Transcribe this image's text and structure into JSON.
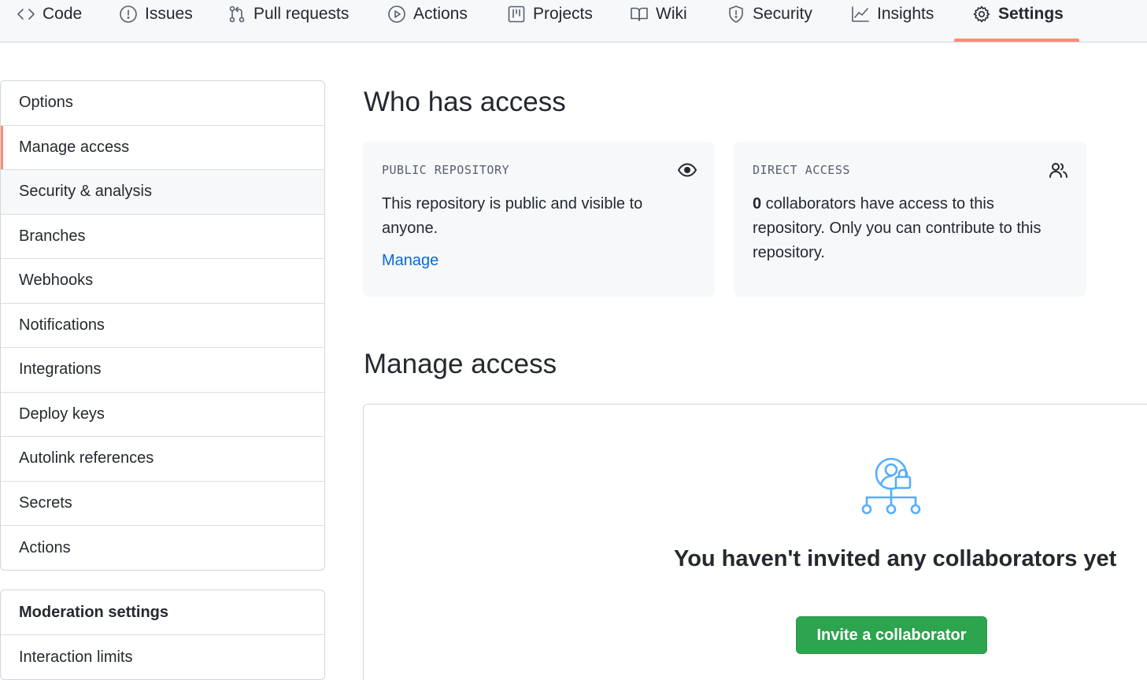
{
  "nav": {
    "tabs": [
      {
        "label": "Code",
        "icon": "code-icon"
      },
      {
        "label": "Issues",
        "icon": "issue-opened-icon"
      },
      {
        "label": "Pull requests",
        "icon": "git-pull-request-icon"
      },
      {
        "label": "Actions",
        "icon": "play-icon"
      },
      {
        "label": "Projects",
        "icon": "project-icon"
      },
      {
        "label": "Wiki",
        "icon": "book-icon"
      },
      {
        "label": "Security",
        "icon": "shield-icon"
      },
      {
        "label": "Insights",
        "icon": "graph-icon"
      },
      {
        "label": "Settings",
        "icon": "gear-icon"
      }
    ],
    "selected": "Settings"
  },
  "sidebar": {
    "items": [
      {
        "label": "Options"
      },
      {
        "label": "Manage access"
      },
      {
        "label": "Security & analysis"
      },
      {
        "label": "Branches"
      },
      {
        "label": "Webhooks"
      },
      {
        "label": "Notifications"
      },
      {
        "label": "Integrations"
      },
      {
        "label": "Deploy keys"
      },
      {
        "label": "Autolink references"
      },
      {
        "label": "Secrets"
      },
      {
        "label": "Actions"
      }
    ],
    "selected": "Manage access",
    "moderation": {
      "heading": "Moderation settings",
      "items": [
        {
          "label": "Interaction limits"
        }
      ]
    }
  },
  "who_has_access": {
    "title": "Who has access",
    "public_card": {
      "kicker": "PUBLIC REPOSITORY",
      "icon": "eye-icon",
      "text": "This repository is public and visible to anyone.",
      "link": "Manage"
    },
    "direct_card": {
      "kicker": "DIRECT ACCESS",
      "icon": "people-icon",
      "count": "0",
      "text": " collaborators have access to this repository. Only you can contribute to this repository."
    }
  },
  "manage_access": {
    "title": "Manage access",
    "empty_icon": "collaborators-lock-icon",
    "empty_title": "You haven't invited any collaborators yet",
    "invite_button": "Invite a collaborator"
  },
  "colors": {
    "accent_underline": "#fd8c73",
    "link": "#0969da",
    "primary_button": "#2da44e",
    "illustration": "#54aeff"
  }
}
